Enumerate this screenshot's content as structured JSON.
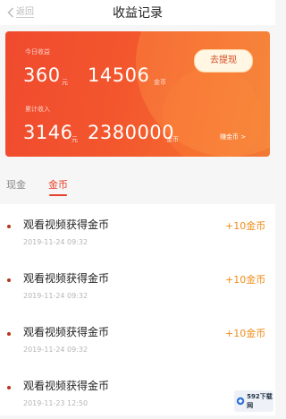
{
  "header": {
    "back_label": "返回",
    "title": "收益记录"
  },
  "summary": {
    "today_label": "今日收益",
    "today_cash": "360",
    "today_cash_unit": "元",
    "today_coins": "14506",
    "today_coins_unit": "金币",
    "total_label": "累计收入",
    "total_cash": "3146",
    "total_cash_unit": "元",
    "total_coins": "2380000",
    "total_coins_unit": "金币",
    "withdraw_label": "去提现",
    "gold_link_label": "赚金币 >"
  },
  "tabs": [
    {
      "label": "现金",
      "active": false
    },
    {
      "label": "金币",
      "active": true
    }
  ],
  "records": [
    {
      "title": "观看视频获得金币",
      "time": "2019-11-24 09:32",
      "amount": "+10金币"
    },
    {
      "title": "观看视频获得金币",
      "time": "2019-11-24 09:32",
      "amount": "+10金币"
    },
    {
      "title": "观看视频获得金币",
      "time": "2019-11-24 09:32",
      "amount": "+10金币"
    },
    {
      "title": "观看视频获得金币",
      "time": "2019-11-23 12:50",
      "amount": "+10金币"
    }
  ],
  "watermark": {
    "text": "592下载网"
  },
  "colors": {
    "accent": "#e8402c",
    "amount": "#f08c1a",
    "card": "#f3572d"
  }
}
